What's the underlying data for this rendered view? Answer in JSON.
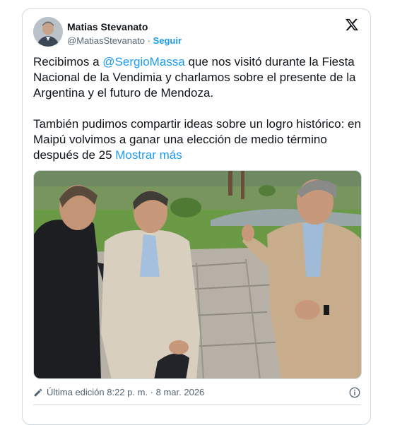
{
  "tweet": {
    "author_name": "Matias Stevanato",
    "handle": "@MatiasStevanato",
    "separator": " · ",
    "follow_label": "Seguir",
    "para1_pre": "Recibimos a ",
    "mention": "@SergioMassa",
    "para1_post": " que nos visitó durante la Fiesta Nacional de la Vendimia y charlamos sobre el presente de la Argentina y el futuro de Mendoza.",
    "para2": "También pudimos compartir ideas sobre un logro histórico: en Maipú volvimos a ganar una elección de medio término después de 25 ",
    "show_more": "Mostrar más",
    "edit_info": "Última edición 8:22 p. m. · 8 mar. 2026"
  },
  "icons": {
    "brand": "x-logo-icon",
    "edited": "pencil-icon",
    "details": "info-icon"
  },
  "colors": {
    "link": "#1d9bf0",
    "text": "#0f1419",
    "muted": "#536471",
    "border": "#cfd9de"
  }
}
